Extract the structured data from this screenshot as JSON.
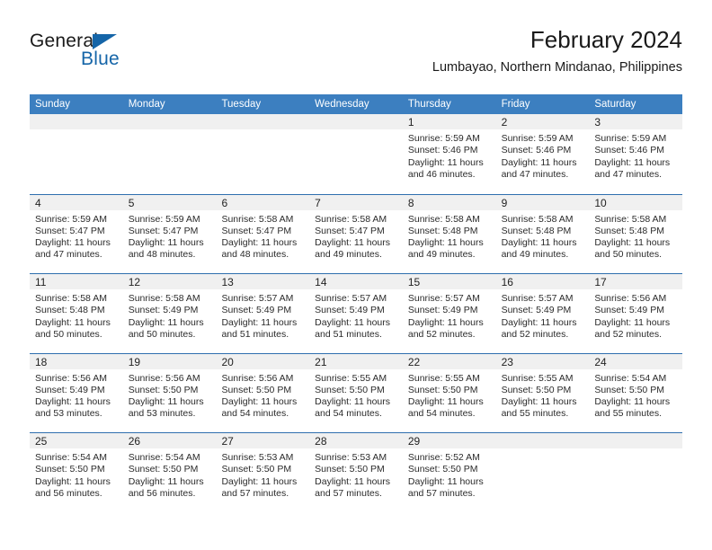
{
  "logo": {
    "primary_text": "General",
    "secondary_text": "Blue",
    "triangle_color": "#1565a8",
    "blue_color": "#1565a8"
  },
  "header": {
    "title": "February 2024",
    "subtitle": "Lumbayao, Northern Mindanao, Philippines"
  },
  "theme": {
    "header_row_bg": "#3c7fc0",
    "row_divider": "#2f6fae",
    "daynum_band_bg": "#f0f0f0",
    "cell_bg": "#ffffff",
    "text": "#2b2b2b"
  },
  "weekdays": [
    "Sunday",
    "Monday",
    "Tuesday",
    "Wednesday",
    "Thursday",
    "Friday",
    "Saturday"
  ],
  "weeks": [
    [
      {
        "day": "",
        "empty": true,
        "sunrise": "",
        "sunset": "",
        "daylight_1": "",
        "daylight_2": ""
      },
      {
        "day": "",
        "empty": true,
        "sunrise": "",
        "sunset": "",
        "daylight_1": "",
        "daylight_2": ""
      },
      {
        "day": "",
        "empty": true,
        "sunrise": "",
        "sunset": "",
        "daylight_1": "",
        "daylight_2": ""
      },
      {
        "day": "",
        "empty": true,
        "sunrise": "",
        "sunset": "",
        "daylight_1": "",
        "daylight_2": ""
      },
      {
        "day": "1",
        "empty": false,
        "sunrise": "Sunrise: 5:59 AM",
        "sunset": "Sunset: 5:46 PM",
        "daylight_1": "Daylight: 11 hours",
        "daylight_2": "and 46 minutes."
      },
      {
        "day": "2",
        "empty": false,
        "sunrise": "Sunrise: 5:59 AM",
        "sunset": "Sunset: 5:46 PM",
        "daylight_1": "Daylight: 11 hours",
        "daylight_2": "and 47 minutes."
      },
      {
        "day": "3",
        "empty": false,
        "sunrise": "Sunrise: 5:59 AM",
        "sunset": "Sunset: 5:46 PM",
        "daylight_1": "Daylight: 11 hours",
        "daylight_2": "and 47 minutes."
      }
    ],
    [
      {
        "day": "4",
        "empty": false,
        "sunrise": "Sunrise: 5:59 AM",
        "sunset": "Sunset: 5:47 PM",
        "daylight_1": "Daylight: 11 hours",
        "daylight_2": "and 47 minutes."
      },
      {
        "day": "5",
        "empty": false,
        "sunrise": "Sunrise: 5:59 AM",
        "sunset": "Sunset: 5:47 PM",
        "daylight_1": "Daylight: 11 hours",
        "daylight_2": "and 48 minutes."
      },
      {
        "day": "6",
        "empty": false,
        "sunrise": "Sunrise: 5:58 AM",
        "sunset": "Sunset: 5:47 PM",
        "daylight_1": "Daylight: 11 hours",
        "daylight_2": "and 48 minutes."
      },
      {
        "day": "7",
        "empty": false,
        "sunrise": "Sunrise: 5:58 AM",
        "sunset": "Sunset: 5:47 PM",
        "daylight_1": "Daylight: 11 hours",
        "daylight_2": "and 49 minutes."
      },
      {
        "day": "8",
        "empty": false,
        "sunrise": "Sunrise: 5:58 AM",
        "sunset": "Sunset: 5:48 PM",
        "daylight_1": "Daylight: 11 hours",
        "daylight_2": "and 49 minutes."
      },
      {
        "day": "9",
        "empty": false,
        "sunrise": "Sunrise: 5:58 AM",
        "sunset": "Sunset: 5:48 PM",
        "daylight_1": "Daylight: 11 hours",
        "daylight_2": "and 49 minutes."
      },
      {
        "day": "10",
        "empty": false,
        "sunrise": "Sunrise: 5:58 AM",
        "sunset": "Sunset: 5:48 PM",
        "daylight_1": "Daylight: 11 hours",
        "daylight_2": "and 50 minutes."
      }
    ],
    [
      {
        "day": "11",
        "empty": false,
        "sunrise": "Sunrise: 5:58 AM",
        "sunset": "Sunset: 5:48 PM",
        "daylight_1": "Daylight: 11 hours",
        "daylight_2": "and 50 minutes."
      },
      {
        "day": "12",
        "empty": false,
        "sunrise": "Sunrise: 5:58 AM",
        "sunset": "Sunset: 5:49 PM",
        "daylight_1": "Daylight: 11 hours",
        "daylight_2": "and 50 minutes."
      },
      {
        "day": "13",
        "empty": false,
        "sunrise": "Sunrise: 5:57 AM",
        "sunset": "Sunset: 5:49 PM",
        "daylight_1": "Daylight: 11 hours",
        "daylight_2": "and 51 minutes."
      },
      {
        "day": "14",
        "empty": false,
        "sunrise": "Sunrise: 5:57 AM",
        "sunset": "Sunset: 5:49 PM",
        "daylight_1": "Daylight: 11 hours",
        "daylight_2": "and 51 minutes."
      },
      {
        "day": "15",
        "empty": false,
        "sunrise": "Sunrise: 5:57 AM",
        "sunset": "Sunset: 5:49 PM",
        "daylight_1": "Daylight: 11 hours",
        "daylight_2": "and 52 minutes."
      },
      {
        "day": "16",
        "empty": false,
        "sunrise": "Sunrise: 5:57 AM",
        "sunset": "Sunset: 5:49 PM",
        "daylight_1": "Daylight: 11 hours",
        "daylight_2": "and 52 minutes."
      },
      {
        "day": "17",
        "empty": false,
        "sunrise": "Sunrise: 5:56 AM",
        "sunset": "Sunset: 5:49 PM",
        "daylight_1": "Daylight: 11 hours",
        "daylight_2": "and 52 minutes."
      }
    ],
    [
      {
        "day": "18",
        "empty": false,
        "sunrise": "Sunrise: 5:56 AM",
        "sunset": "Sunset: 5:49 PM",
        "daylight_1": "Daylight: 11 hours",
        "daylight_2": "and 53 minutes."
      },
      {
        "day": "19",
        "empty": false,
        "sunrise": "Sunrise: 5:56 AM",
        "sunset": "Sunset: 5:50 PM",
        "daylight_1": "Daylight: 11 hours",
        "daylight_2": "and 53 minutes."
      },
      {
        "day": "20",
        "empty": false,
        "sunrise": "Sunrise: 5:56 AM",
        "sunset": "Sunset: 5:50 PM",
        "daylight_1": "Daylight: 11 hours",
        "daylight_2": "and 54 minutes."
      },
      {
        "day": "21",
        "empty": false,
        "sunrise": "Sunrise: 5:55 AM",
        "sunset": "Sunset: 5:50 PM",
        "daylight_1": "Daylight: 11 hours",
        "daylight_2": "and 54 minutes."
      },
      {
        "day": "22",
        "empty": false,
        "sunrise": "Sunrise: 5:55 AM",
        "sunset": "Sunset: 5:50 PM",
        "daylight_1": "Daylight: 11 hours",
        "daylight_2": "and 54 minutes."
      },
      {
        "day": "23",
        "empty": false,
        "sunrise": "Sunrise: 5:55 AM",
        "sunset": "Sunset: 5:50 PM",
        "daylight_1": "Daylight: 11 hours",
        "daylight_2": "and 55 minutes."
      },
      {
        "day": "24",
        "empty": false,
        "sunrise": "Sunrise: 5:54 AM",
        "sunset": "Sunset: 5:50 PM",
        "daylight_1": "Daylight: 11 hours",
        "daylight_2": "and 55 minutes."
      }
    ],
    [
      {
        "day": "25",
        "empty": false,
        "sunrise": "Sunrise: 5:54 AM",
        "sunset": "Sunset: 5:50 PM",
        "daylight_1": "Daylight: 11 hours",
        "daylight_2": "and 56 minutes."
      },
      {
        "day": "26",
        "empty": false,
        "sunrise": "Sunrise: 5:54 AM",
        "sunset": "Sunset: 5:50 PM",
        "daylight_1": "Daylight: 11 hours",
        "daylight_2": "and 56 minutes."
      },
      {
        "day": "27",
        "empty": false,
        "sunrise": "Sunrise: 5:53 AM",
        "sunset": "Sunset: 5:50 PM",
        "daylight_1": "Daylight: 11 hours",
        "daylight_2": "and 57 minutes."
      },
      {
        "day": "28",
        "empty": false,
        "sunrise": "Sunrise: 5:53 AM",
        "sunset": "Sunset: 5:50 PM",
        "daylight_1": "Daylight: 11 hours",
        "daylight_2": "and 57 minutes."
      },
      {
        "day": "29",
        "empty": false,
        "sunrise": "Sunrise: 5:52 AM",
        "sunset": "Sunset: 5:50 PM",
        "daylight_1": "Daylight: 11 hours",
        "daylight_2": "and 57 minutes."
      },
      {
        "day": "",
        "empty": true,
        "sunrise": "",
        "sunset": "",
        "daylight_1": "",
        "daylight_2": ""
      },
      {
        "day": "",
        "empty": true,
        "sunrise": "",
        "sunset": "",
        "daylight_1": "",
        "daylight_2": ""
      }
    ]
  ]
}
